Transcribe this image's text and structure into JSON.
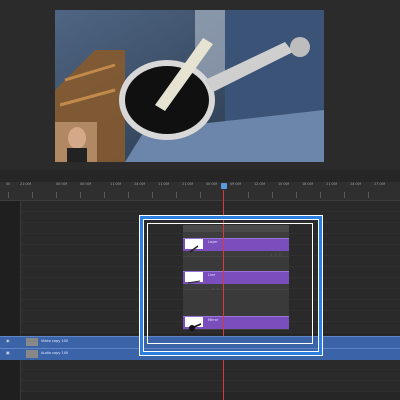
{
  "ruler": {
    "ticks": [
      "00",
      "21:00f",
      "00:00f",
      "00:00f",
      "11:00f",
      "24:00f",
      "11:00f",
      "21:00f",
      "00:00f",
      "09:00f",
      "12:00f",
      "15:00f",
      "18:00f",
      "21:00f",
      "24:00f",
      "27:00f",
      "30:00f"
    ]
  },
  "layers": [
    {
      "label": "Layer"
    },
    {
      "label": "Line"
    },
    {
      "label": "Mirror"
    }
  ],
  "tracks": [
    {
      "label": "Video copy 100"
    },
    {
      "label": "Audio copy 100"
    }
  ],
  "colors": {
    "layer_bar": "#7a4fbd",
    "main_track": "#3b63a8",
    "highlight": "#2a7fe0",
    "playhead": "#d83a3a"
  },
  "icons": {
    "eye": "eye-icon",
    "lock": "lock-icon",
    "clip": "film-icon"
  }
}
